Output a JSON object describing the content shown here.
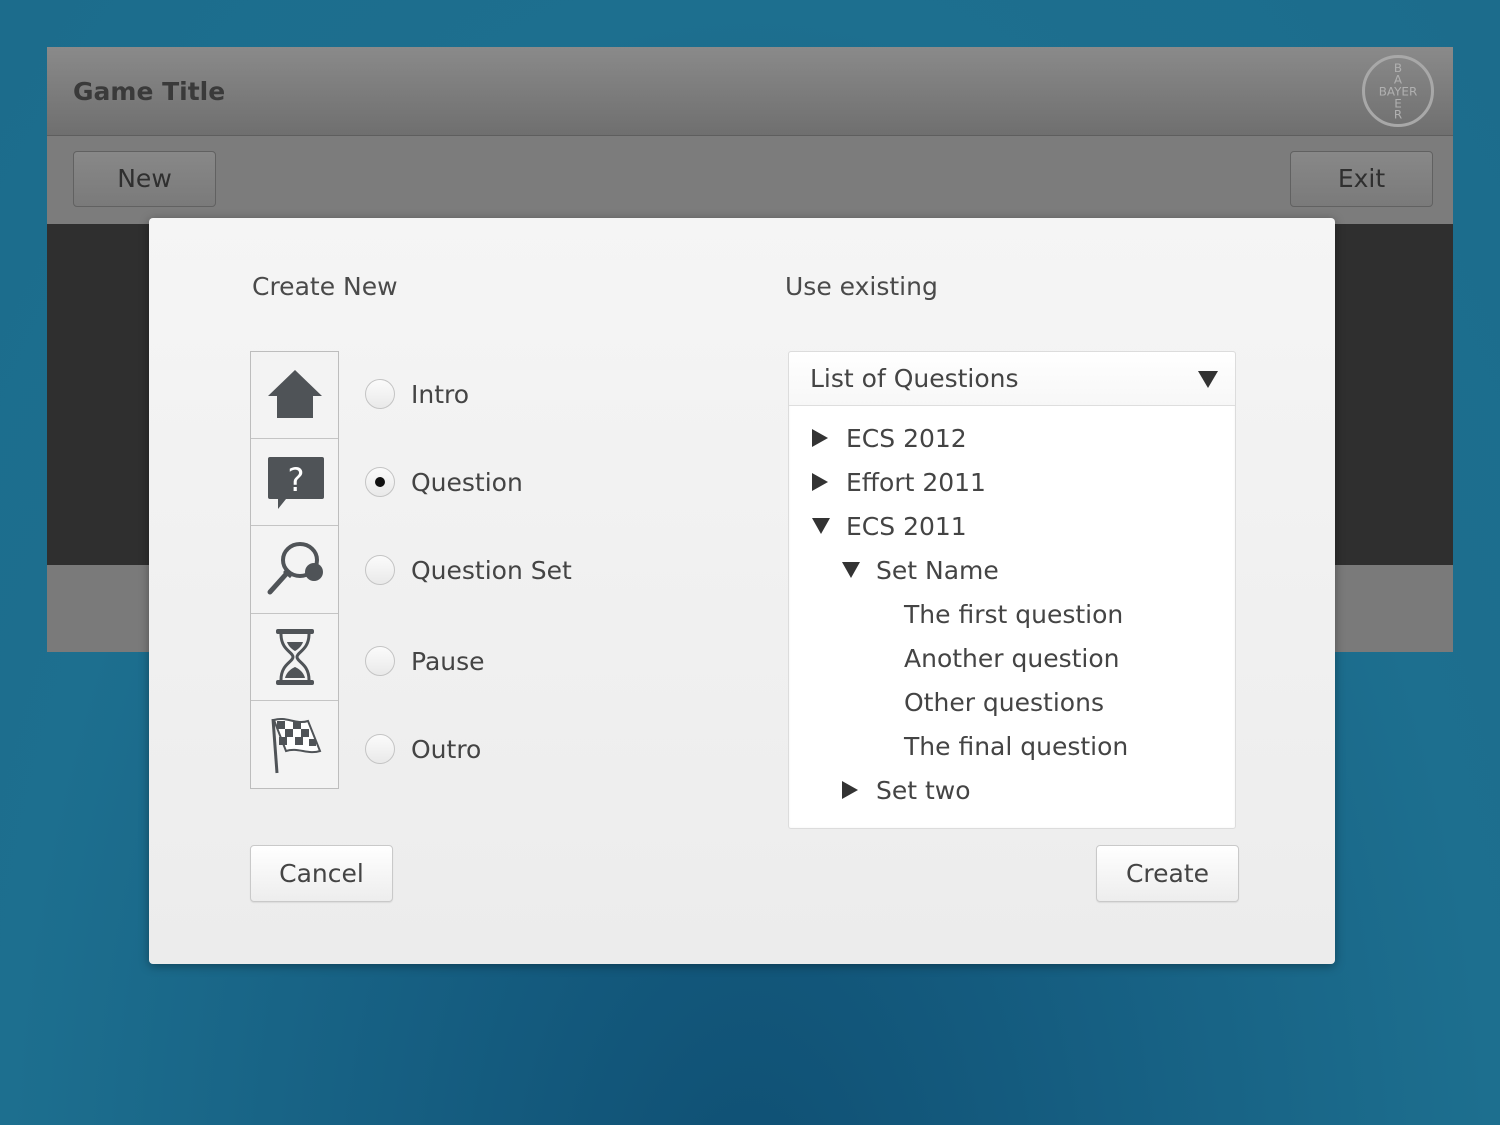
{
  "app": {
    "title": "Game Title",
    "logo_letters": "BAYER",
    "toolbar": {
      "new_label": "New",
      "exit_label": "Exit"
    }
  },
  "dialog": {
    "create_new_title": "Create New",
    "use_existing_title": "Use existing",
    "options": [
      {
        "label": "Intro",
        "icon": "house-icon",
        "checked": false
      },
      {
        "label": "Question",
        "icon": "question-bubble-icon",
        "checked": true
      },
      {
        "label": "Question Set",
        "icon": "racket-icon",
        "checked": false
      },
      {
        "label": "Pause",
        "icon": "hourglass-icon",
        "checked": false
      },
      {
        "label": "Outro",
        "icon": "checkered-flag-icon",
        "checked": false
      }
    ],
    "dropdown": {
      "selected": "List of Questions"
    },
    "tree": [
      {
        "label": "ECS 2012",
        "expander": "collapsed",
        "level": 0
      },
      {
        "label": "Effort 2011",
        "expander": "collapsed",
        "level": 0
      },
      {
        "label": "ECS 2011",
        "expander": "expanded",
        "level": 0
      },
      {
        "label": "Set Name",
        "expander": "expanded",
        "level": 1
      },
      {
        "label": "The first question",
        "expander": "none",
        "level": 2
      },
      {
        "label": "Another question",
        "expander": "none",
        "level": 2
      },
      {
        "label": "Other questions",
        "expander": "none",
        "level": 2
      },
      {
        "label": "The final question",
        "expander": "none",
        "level": 2
      },
      {
        "label": "Set two",
        "expander": "collapsed",
        "level": 1
      }
    ],
    "cancel_label": "Cancel",
    "create_label": "Create"
  },
  "colors": {
    "background": "#1d6f8f",
    "dialog": "#f0f0f0",
    "icon_fill": "#4f5357"
  }
}
